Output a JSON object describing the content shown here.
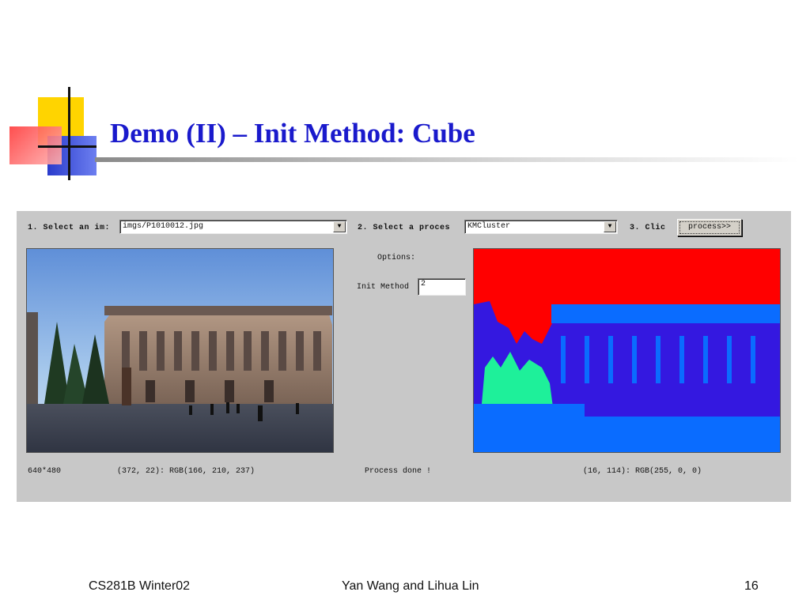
{
  "slide": {
    "title": "Demo (II) – Init Method: Cube"
  },
  "app": {
    "step1_label": "1. Select an im:",
    "image_select": {
      "value": "imgs/P1010012.jpg"
    },
    "step2_label": "2. Select a proces",
    "process_select": {
      "value": "KMCluster"
    },
    "step3_label": "3. Clic",
    "process_button": "process>>",
    "options_label": "Options:",
    "init_method_label": "Init Method",
    "init_method_value": "2",
    "image_size": "640*480",
    "left_pixel_info": "(372, 22): RGB(166, 210, 237)",
    "status": "Process done !",
    "right_pixel_info": "(16, 114): RGB(255, 0, 0)"
  },
  "colors": {
    "title": "#1a1acc",
    "segment_red": "#ff0000",
    "segment_blue": "#0a6cff",
    "segment_indigo": "#3418e0",
    "segment_green": "#1ef09a"
  },
  "footer": {
    "left": "CS281B Winter02",
    "center": "Yan Wang and Lihua Lin",
    "page_number": "16"
  }
}
